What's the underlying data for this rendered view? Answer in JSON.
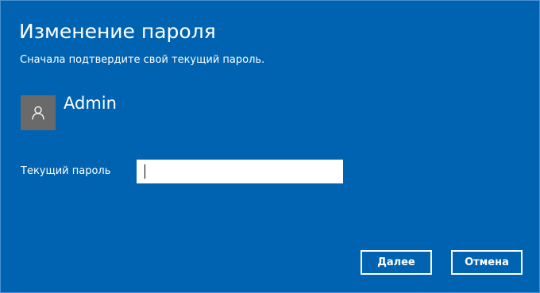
{
  "dialog": {
    "title": "Изменение пароля",
    "subtitle": "Сначала подтвердите свой текущий пароль."
  },
  "user": {
    "avatar_icon": "user-icon",
    "name": "Admin"
  },
  "form": {
    "current_password_label": "Текущий пароль",
    "current_password_value": "",
    "current_password_placeholder": ""
  },
  "buttons": {
    "next_label": "Далее",
    "cancel_label": "Отмена"
  },
  "colors": {
    "background": "#0063b1",
    "avatar_bg": "#6a6a6a",
    "text": "#ffffff"
  }
}
